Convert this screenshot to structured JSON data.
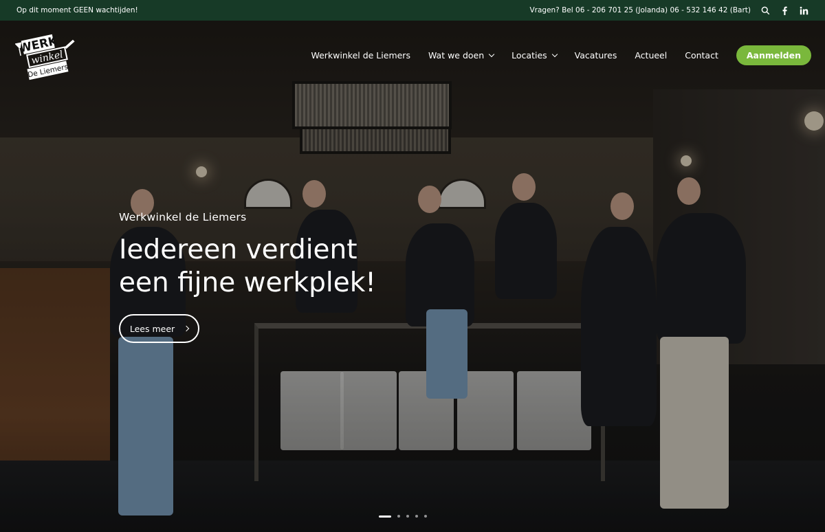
{
  "topbar": {
    "notice": "Op dit moment GEEN wachtijden!",
    "contact": "Vragen? Bel 06 - 206 701 25 (Jolanda) 06 - 532 146 42 (Bart)",
    "icons": [
      "search-icon",
      "facebook-icon",
      "linkedin-icon"
    ]
  },
  "logo": {
    "line1": "WERK",
    "line2": "winkel",
    "line3": "De Liemers"
  },
  "nav": {
    "items": [
      {
        "label": "Werkwinkel de Liemers",
        "dropdown": false
      },
      {
        "label": "Wat we doen",
        "dropdown": true
      },
      {
        "label": "Locaties",
        "dropdown": true
      },
      {
        "label": "Vacatures",
        "dropdown": false
      },
      {
        "label": "Actueel",
        "dropdown": false
      },
      {
        "label": "Contact",
        "dropdown": false
      }
    ],
    "cta": "Aanmelden"
  },
  "hero": {
    "eyebrow": "Werkwinkel de Liemers",
    "headline_line1": "Iedereen verdient",
    "headline_line2": "een fijne werkplek!",
    "button": "Lees meer"
  },
  "slider": {
    "count": 5,
    "active": 1
  },
  "colors": {
    "topbar_bg": "#173a27",
    "accent": "#7ab83c"
  }
}
